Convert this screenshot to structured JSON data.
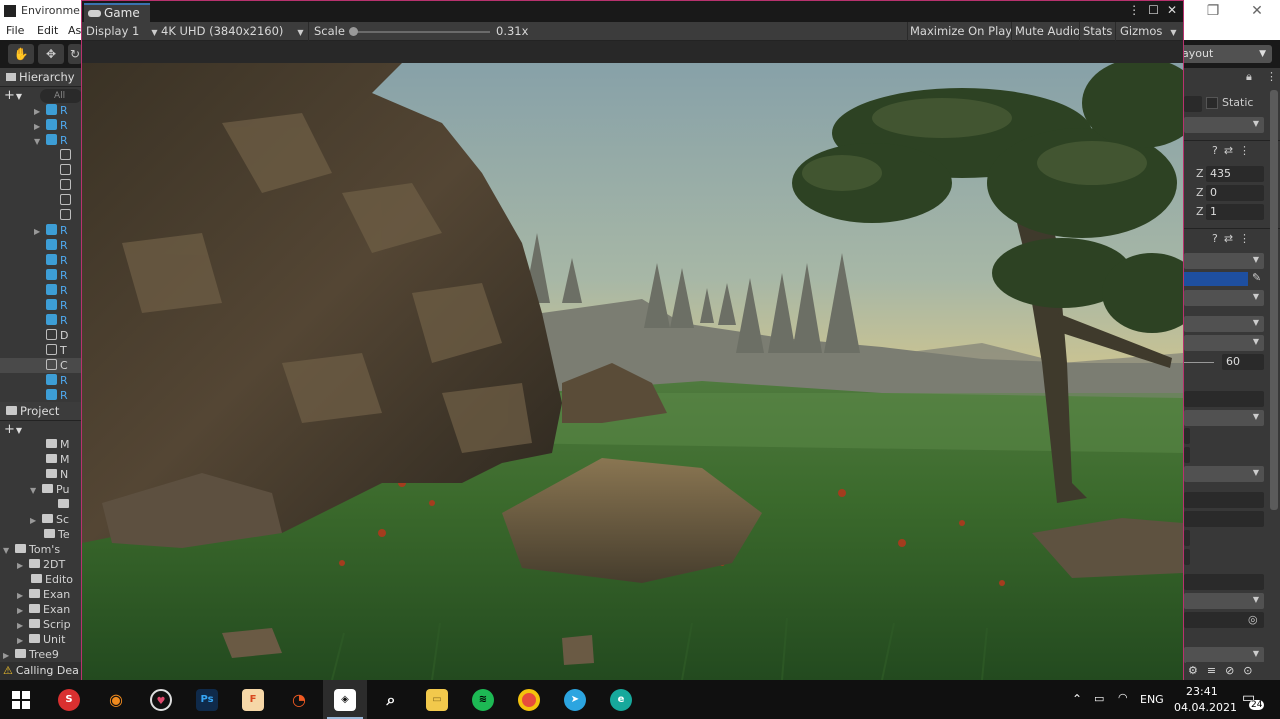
{
  "unity": {
    "window_title": "Environment",
    "menu": [
      "File",
      "Edit",
      "As"
    ],
    "layout_label": "ayout"
  },
  "hierarchy": {
    "tab_label": "Hierarchy",
    "search_placeholder": "All",
    "rows": [
      {
        "label": "R",
        "type": "blue",
        "arrow": "▶",
        "indent": 46
      },
      {
        "label": "R",
        "type": "blue",
        "arrow": "▶",
        "indent": 46
      },
      {
        "label": "R",
        "type": "blue",
        "arrow": "▼",
        "indent": 46
      },
      {
        "label": "",
        "type": "white",
        "arrow": "",
        "indent": 60
      },
      {
        "label": "",
        "type": "white",
        "arrow": "",
        "indent": 60
      },
      {
        "label": "",
        "type": "white",
        "arrow": "",
        "indent": 60
      },
      {
        "label": "",
        "type": "white",
        "arrow": "",
        "indent": 60
      },
      {
        "label": "",
        "type": "white",
        "arrow": "",
        "indent": 60
      },
      {
        "label": "R",
        "type": "blue",
        "arrow": "▶",
        "indent": 46
      },
      {
        "label": "R",
        "type": "blue",
        "arrow": "",
        "indent": 46
      },
      {
        "label": "R",
        "type": "blue",
        "arrow": "",
        "indent": 46
      },
      {
        "label": "R",
        "type": "blue",
        "arrow": "",
        "indent": 46
      },
      {
        "label": "R",
        "type": "blue",
        "arrow": "",
        "indent": 46
      },
      {
        "label": "R",
        "type": "blue",
        "arrow": "",
        "indent": 46
      },
      {
        "label": "R",
        "type": "blue",
        "arrow": "",
        "indent": 46
      },
      {
        "label": "D",
        "type": "white",
        "arrow": "",
        "indent": 46
      },
      {
        "label": "T",
        "type": "white",
        "arrow": "",
        "indent": 46
      },
      {
        "label": "C",
        "type": "white",
        "arrow": "",
        "indent": 46
      },
      {
        "label": "R",
        "type": "blue",
        "arrow": "",
        "indent": 46
      },
      {
        "label": "R",
        "type": "blue",
        "arrow": "",
        "indent": 46
      }
    ]
  },
  "project": {
    "tab_label": "Project",
    "rows": [
      {
        "label": "M",
        "arrow": "",
        "indent": 46
      },
      {
        "label": "M",
        "arrow": "",
        "indent": 46
      },
      {
        "label": "N",
        "arrow": "",
        "indent": 46
      },
      {
        "label": "Pu",
        "arrow": "▼",
        "indent": 44
      },
      {
        "label": "",
        "arrow": "",
        "indent": 58
      },
      {
        "label": "Sc",
        "arrow": "▶",
        "indent": 44
      },
      {
        "label": "Te",
        "arrow": "",
        "indent": 44
      },
      {
        "label": "Tom's",
        "arrow": "▼",
        "indent": 17
      },
      {
        "label": "2DT",
        "arrow": "▶",
        "indent": 31
      },
      {
        "label": "Edito",
        "arrow": "",
        "indent": 31
      },
      {
        "label": "Exan",
        "arrow": "▶",
        "indent": 31
      },
      {
        "label": "Exan",
        "arrow": "▶",
        "indent": 31
      },
      {
        "label": "Scrip",
        "arrow": "▶",
        "indent": 31
      },
      {
        "label": "Unit",
        "arrow": "▶",
        "indent": 31
      },
      {
        "label": "Tree9",
        "arrow": "▶",
        "indent": 17
      }
    ]
  },
  "console": {
    "message": "Calling Dea"
  },
  "game_window": {
    "tab_label": "Game",
    "display": "Display 1",
    "resolution": "4K UHD (3840x2160)",
    "scale_label": "Scale",
    "scale_value": "0.31x",
    "scale_fraction": 0.0,
    "maximize_label": "Maximize On Play",
    "mute_label": "Mute Audio",
    "stats_label": "Stats",
    "gizmos_label": "Gizmos"
  },
  "inspector": {
    "static_label": "Static",
    "z_rows": [
      {
        "axis": "Z",
        "value": "435"
      },
      {
        "axis": "Z",
        "value": "0"
      },
      {
        "axis": "Z",
        "value": "1"
      }
    ],
    "field_60": "60",
    "color_swatch": "#1e4fa0"
  },
  "taskbar": {
    "language": "ENG",
    "time": "23:41",
    "date": "04.04.2021",
    "notification_count": "24"
  }
}
